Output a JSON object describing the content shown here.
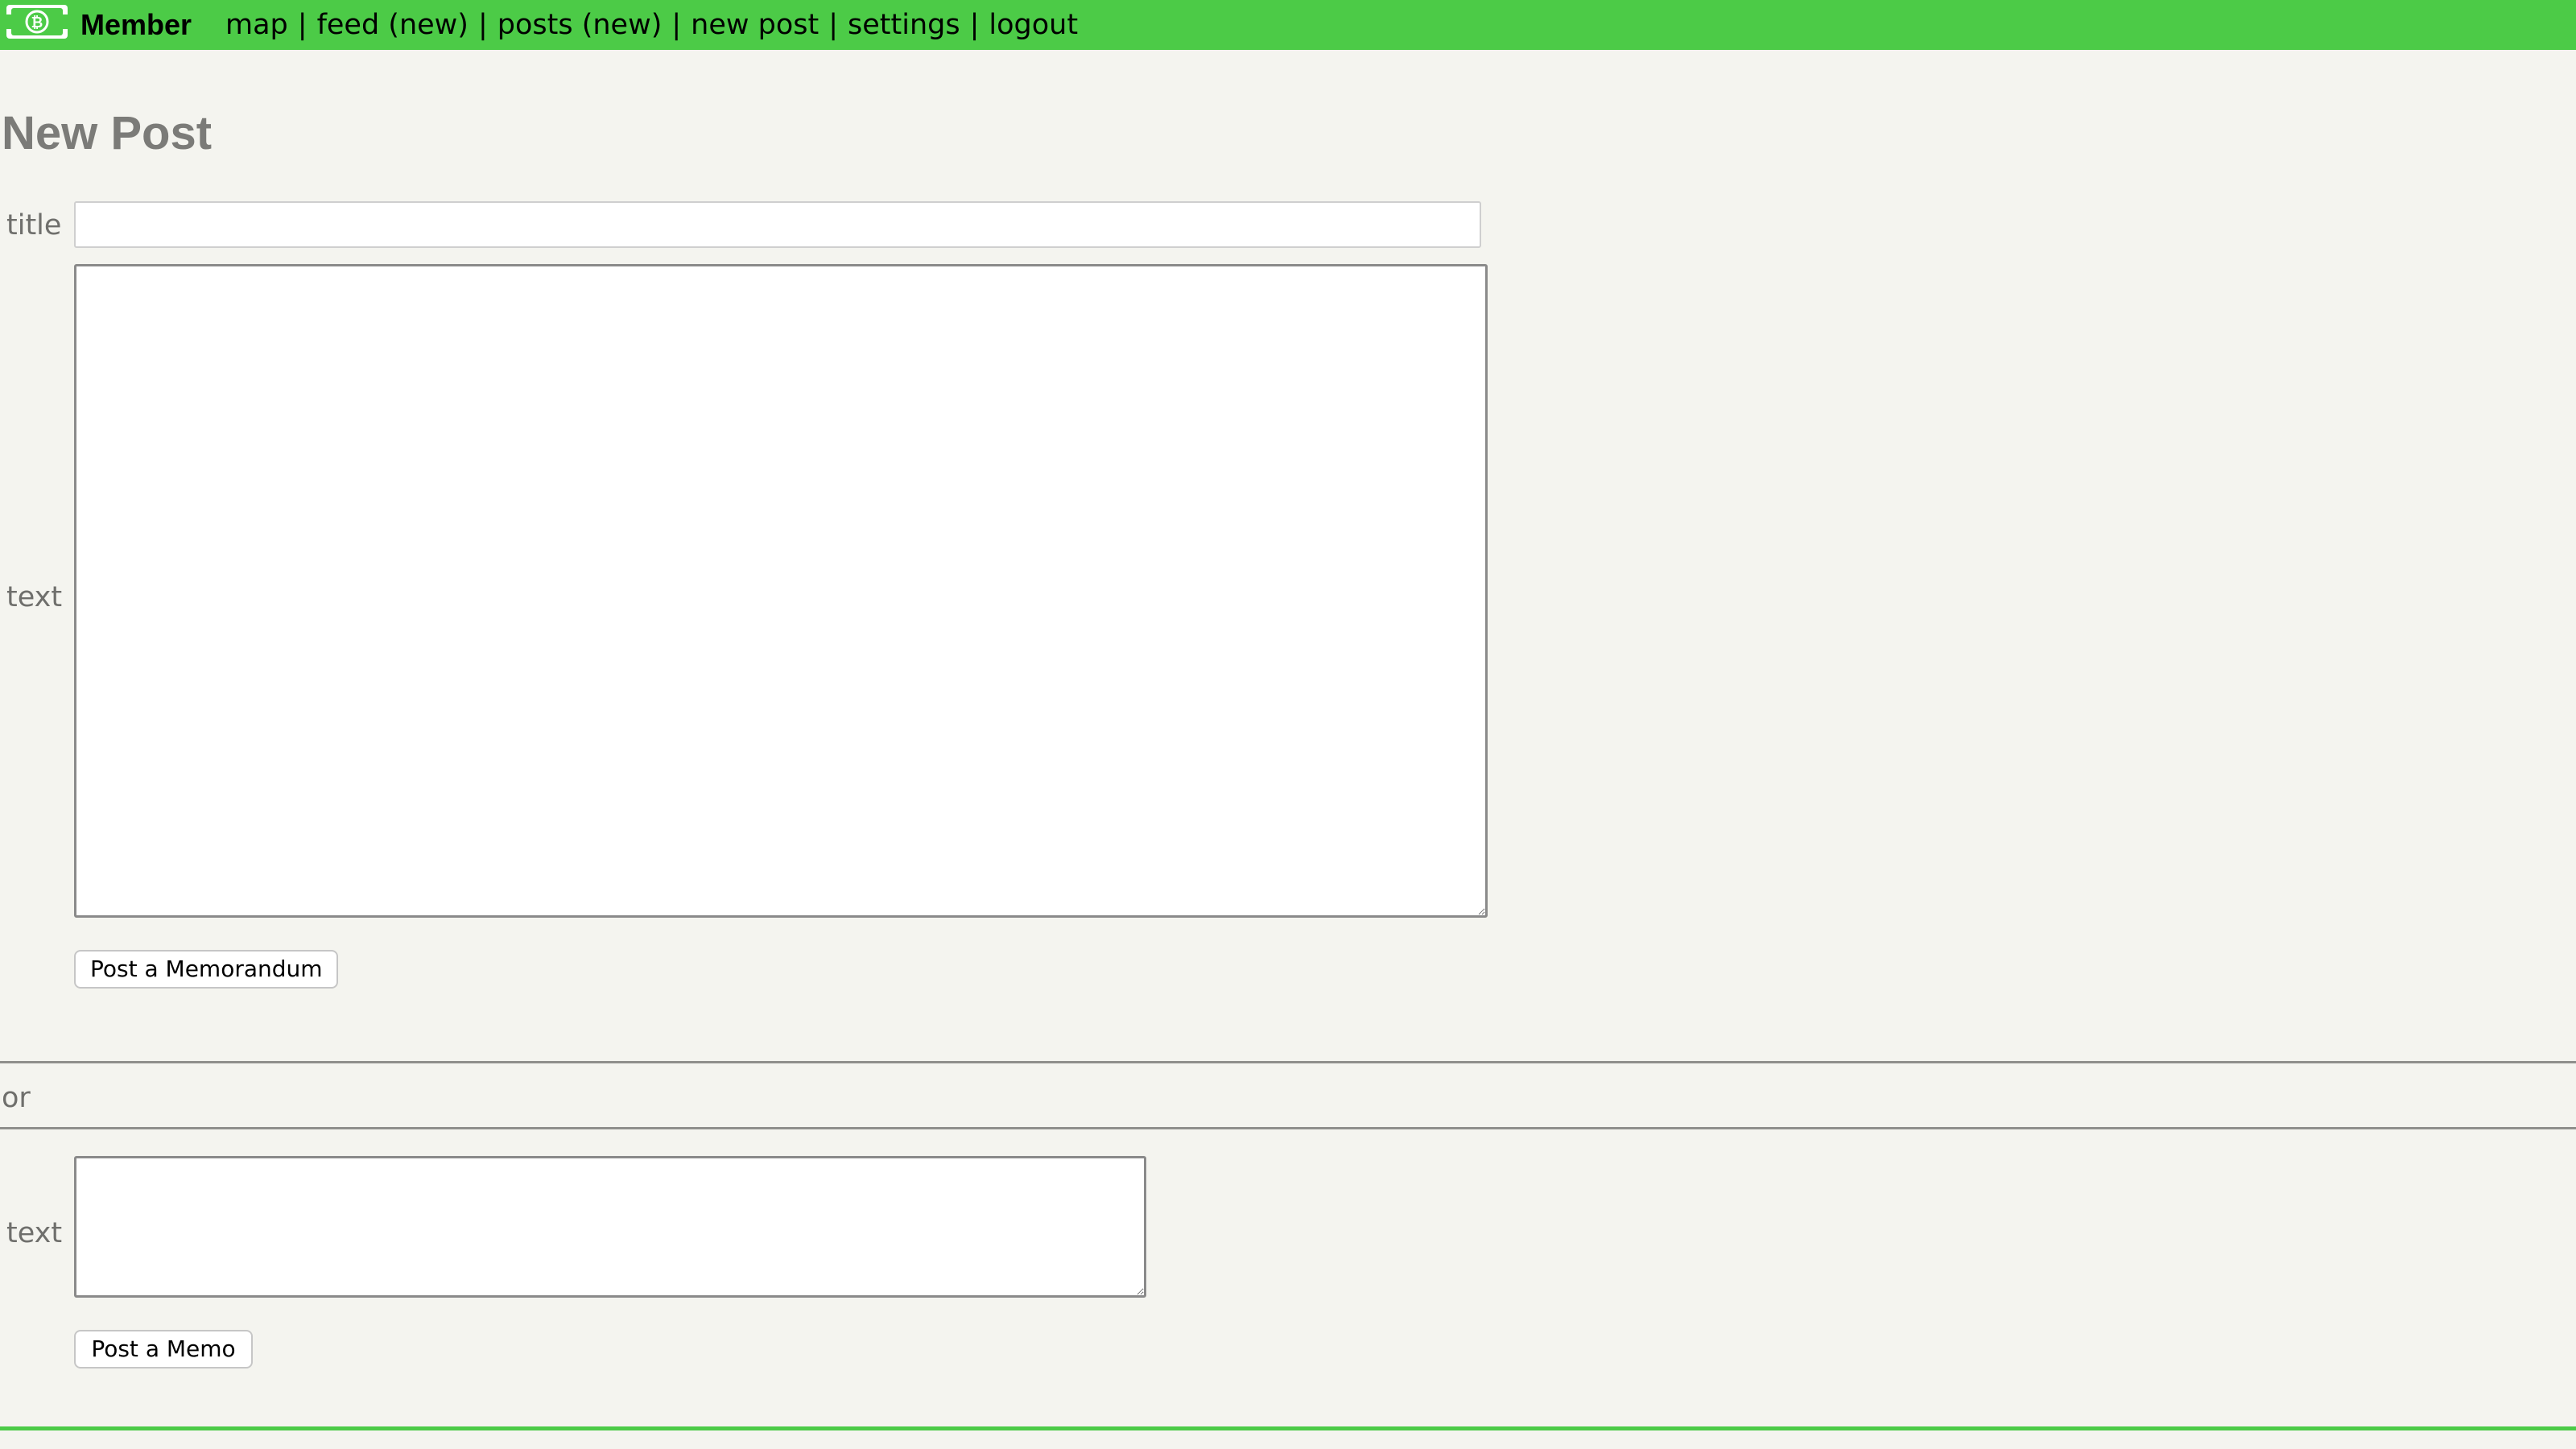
{
  "header": {
    "brand": "Member",
    "nav": [
      "map",
      "feed (new)",
      "posts (new)",
      "new post",
      "settings",
      "logout"
    ],
    "separator": "|",
    "colors": {
      "bar": "#4ccb47"
    },
    "logo_icon": "bitcoin-cash-logo-icon"
  },
  "page": {
    "title": "New Post"
  },
  "memorandum_form": {
    "title_label": "title",
    "title_value": "",
    "text_label": "text",
    "text_value": "",
    "submit_label": "Post a Memorandum"
  },
  "divider": {
    "or_label": "or"
  },
  "memo_form": {
    "text_label": "text",
    "text_value": "",
    "submit_label": "Post a Memo"
  }
}
